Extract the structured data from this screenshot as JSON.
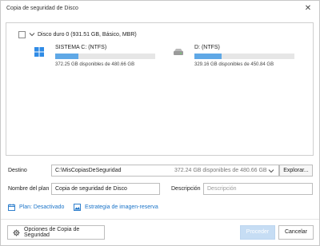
{
  "window": {
    "title": "Copia de seguridad de Disco",
    "close_glyph": "✕"
  },
  "disk": {
    "title": "Disco duro 0 (931.51 GB, Básico, MBR)",
    "checked": false,
    "partitions": [
      {
        "name": "SISTEMA C: (NTFS)",
        "size": "372.25 GB disponibles de 480.66 GB",
        "used_fraction": 0.23,
        "icon": "windows-drive-icon"
      },
      {
        "name": "D: (NTFS)",
        "size": "329.16 GB disponibles de 450.84 GB",
        "used_fraction": 0.27,
        "icon": "drive-icon"
      }
    ]
  },
  "destination": {
    "label": "Destino",
    "path": "C:\\MisCopiasDeSeguridad",
    "space": "372.24 GB disponibles de 480.66 GB",
    "browse_label": "Explorar..."
  },
  "plan": {
    "name_label": "Nombre del plan",
    "name_value": "Copia de seguridad de Disco",
    "desc_label": "Descripción",
    "desc_placeholder": "Descripción"
  },
  "links": {
    "plan_status": "Plan: Desactivado",
    "image_strategy": "Estrategia de imagen-reserva"
  },
  "footer": {
    "options_label": "Opciones de Copia de Seguridad",
    "proceed_label": "Proceder",
    "cancel_label": "Cancelar"
  },
  "colors": {
    "accent": "#1a73c8",
    "bar_fill": "#5fa8e6",
    "proceed_disabled": "#c6ddf4"
  }
}
